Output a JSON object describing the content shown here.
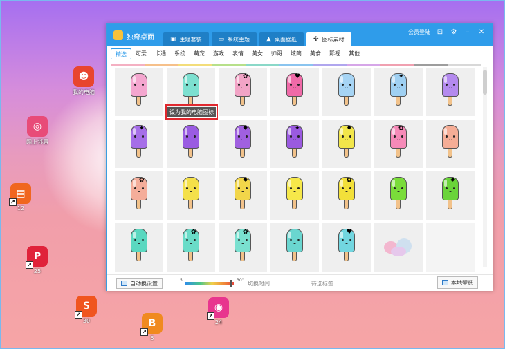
{
  "desktop_icons": [
    {
      "label": "我的电脑",
      "color": "#e8452f",
      "glyph": "☻",
      "shortcut": false
    },
    {
      "label": "网上邻居",
      "color": "#e84b78",
      "glyph": "◎",
      "shortcut": false
    },
    {
      "label": "12",
      "color": "#f0661f",
      "glyph": "▤",
      "shortcut": true
    },
    {
      "label": "25",
      "color": "#e0223a",
      "glyph": "P",
      "shortcut": true
    },
    {
      "label": "30",
      "color": "#f0551f",
      "glyph": "S",
      "shortcut": true
    },
    {
      "label": "24",
      "color": "#e8358e",
      "glyph": "◉",
      "shortcut": true
    },
    {
      "label": "5",
      "color": "#f08a1f",
      "glyph": "B",
      "shortcut": true
    }
  ],
  "window": {
    "title": "独奇桌面",
    "tabs": [
      {
        "label": "主题套装",
        "icon": "folder-icon"
      },
      {
        "label": "系统主题",
        "icon": "monitor-icon"
      },
      {
        "label": "桌面壁纸",
        "icon": "picture-icon"
      },
      {
        "label": "图标素材",
        "icon": "sparkle-icon"
      }
    ],
    "active_tab": 3,
    "login": "会员登陆"
  },
  "categories": [
    "精选",
    "可爱",
    "卡通",
    "系统",
    "萌宠",
    "游戏",
    "表情",
    "美女",
    "帅哥",
    "炫简",
    "美食",
    "影视",
    "其他"
  ],
  "active_category": 0,
  "rainbow_colors": [
    "#f4b0c2",
    "#f6c08a",
    "#f3dd7a",
    "#b7e08a",
    "#8ad8c8",
    "#8ac4ef",
    "#b0a6ee",
    "#d6a6e8",
    "#f0a0b0",
    "#9d9d9d",
    "#d8d8d8"
  ],
  "tooltip": "设为我的电脑图标",
  "icons": [
    {
      "color": "#f4a6cf",
      "deco": ""
    },
    {
      "color": "#7de0d0",
      "deco": ""
    },
    {
      "color": "#f2a4c6",
      "deco": "✿"
    },
    {
      "color": "#f06aa8",
      "deco": "♥"
    },
    {
      "color": "#a6d4f4",
      "deco": ""
    },
    {
      "color": "#9fd0f2",
      "deco": "✦"
    },
    {
      "color": "#b48aee",
      "deco": ""
    },
    {
      "color": "#a66ee8",
      "deco": "✦"
    },
    {
      "color": "#9a5ce2",
      "deco": ""
    },
    {
      "color": "#a060e0",
      "deco": "✸"
    },
    {
      "color": "#9a5ae0",
      "deco": "✦"
    },
    {
      "color": "#f2e64a",
      "deco": "✸"
    },
    {
      "color": "#f68ab8",
      "deco": "✿"
    },
    {
      "color": "#f5ad96",
      "deco": ""
    },
    {
      "color": "#f4ad9a",
      "deco": "✿"
    },
    {
      "color": "#f4e04a",
      "deco": ""
    },
    {
      "color": "#f2d64a",
      "deco": "✸"
    },
    {
      "color": "#f6e84a",
      "deco": ""
    },
    {
      "color": "#f2e03a",
      "deco": "✿"
    },
    {
      "color": "#7adc3a",
      "deco": ""
    },
    {
      "color": "#6ad43a",
      "deco": "✸"
    },
    {
      "color": "#5ad8c0",
      "deco": ""
    },
    {
      "color": "#6adcc8",
      "deco": "✿"
    },
    {
      "color": "#7ae0d0",
      "deco": "✿"
    },
    {
      "color": "#6ad6d0",
      "deco": ""
    },
    {
      "color": "#72d6e0",
      "deco": "♥"
    }
  ],
  "footer": {
    "auto_change": "自动换设置",
    "slider_min": "5",
    "slider_max": "30",
    "slider_unit": "\"",
    "interval_label": "切换时间",
    "filter_label": "待选标签",
    "local_wallpaper": "本地壁纸",
    "slider_value_fraction": 0.97
  }
}
